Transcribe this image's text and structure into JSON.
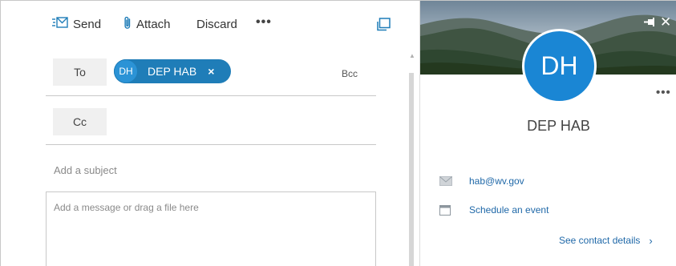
{
  "toolbar": {
    "send_label": "Send",
    "attach_label": "Attach",
    "discard_label": "Discard",
    "more_label": "•••",
    "icons": {
      "send": "envelope-send-icon",
      "attach": "paperclip-icon",
      "popout": "popout-window-icon"
    },
    "accent_color": "#1f7db8"
  },
  "to_field": {
    "label": "To",
    "recipient": {
      "initials": "DH",
      "name": "DEP HAB",
      "remove_glyph": "×"
    },
    "bcc_label": "Bcc"
  },
  "cc_field": {
    "label": "Cc"
  },
  "subject": {
    "value": "",
    "placeholder": "Add a subject"
  },
  "message": {
    "value": "",
    "placeholder": "Add a message or drag a file here"
  },
  "contact_card": {
    "initials": "DH",
    "name": "DEP HAB",
    "more_label": "•••",
    "close_glyph": "✕",
    "email": "hab@wv.gov",
    "schedule_label": "Schedule an event",
    "see_details_label": "See contact details",
    "see_details_chevron": "›",
    "avatar_color": "#1a86d4",
    "link_color": "#1f68a8",
    "icons": {
      "pin": "pin-icon",
      "close": "close-icon",
      "email": "envelope-icon",
      "calendar": "calendar-icon",
      "chevron": "chevron-right-icon"
    }
  }
}
